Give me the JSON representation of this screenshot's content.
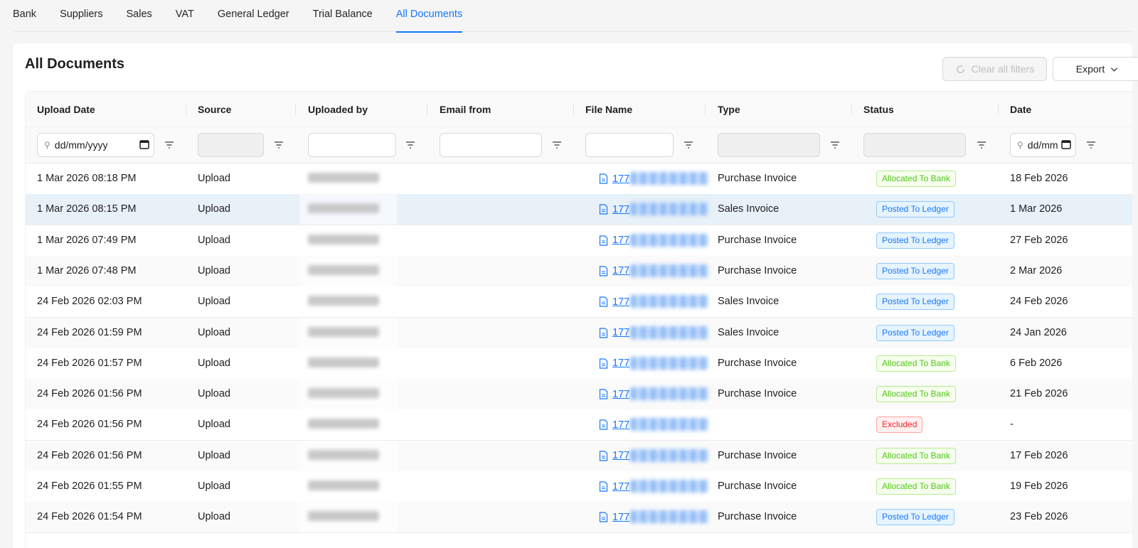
{
  "tabs": [
    {
      "label": "Bank",
      "active": false
    },
    {
      "label": "Suppliers",
      "active": false
    },
    {
      "label": "Sales",
      "active": false
    },
    {
      "label": "VAT",
      "active": false
    },
    {
      "label": "General Ledger",
      "active": false
    },
    {
      "label": "Trial Balance",
      "active": false
    },
    {
      "label": "All Documents",
      "active": true
    }
  ],
  "page": {
    "title": "All Documents",
    "clear_filters_label": "Clear all filters",
    "export_label": "Export"
  },
  "columns": [
    "Upload Date",
    "Source",
    "Uploaded by",
    "Email from",
    "File Name",
    "Type",
    "Status",
    "Date"
  ],
  "filters": {
    "upload_date_placeholder": "dd/mm/yyyy",
    "date_placeholder": "dd/mm"
  },
  "rows": [
    {
      "upload_date": "1 Mar 2026 08:18 PM",
      "source": "Upload",
      "file": "177",
      "type": "Purchase Invoice",
      "status": "Allocated To Bank",
      "status_color": "green",
      "date": "18 Feb 2026"
    },
    {
      "upload_date": "1 Mar 2026 08:15 PM",
      "source": "Upload",
      "file": "177",
      "type": "Sales Invoice",
      "status": "Posted To Ledger",
      "status_color": "blue",
      "date": "1 Mar 2026"
    },
    {
      "upload_date": "1 Mar 2026 07:49 PM",
      "source": "Upload",
      "file": "177",
      "type": "Purchase Invoice",
      "status": "Posted To Ledger",
      "status_color": "blue",
      "date": "27 Feb 2026"
    },
    {
      "upload_date": "1 Mar 2026 07:48 PM",
      "source": "Upload",
      "file": "177",
      "type": "Purchase Invoice",
      "status": "Posted To Ledger",
      "status_color": "blue",
      "date": "2 Mar 2026"
    },
    {
      "upload_date": "24 Feb 2026 02:03 PM",
      "source": "Upload",
      "file": "177",
      "type": "Sales Invoice",
      "status": "Posted To Ledger",
      "status_color": "blue",
      "date": "24 Feb 2026"
    },
    {
      "upload_date": "24 Feb 2026 01:59 PM",
      "source": "Upload",
      "file": "177",
      "type": "Sales Invoice",
      "status": "Posted To Ledger",
      "status_color": "blue",
      "date": "24 Jan 2026"
    },
    {
      "upload_date": "24 Feb 2026 01:57 PM",
      "source": "Upload",
      "file": "177",
      "type": "Purchase Invoice",
      "status": "Allocated To Bank",
      "status_color": "green",
      "date": "6 Feb 2026"
    },
    {
      "upload_date": "24 Feb 2026 01:56 PM",
      "source": "Upload",
      "file": "177",
      "type": "Purchase Invoice",
      "status": "Allocated To Bank",
      "status_color": "green",
      "date": "21 Feb 2026"
    },
    {
      "upload_date": "24 Feb 2026 01:56 PM",
      "source": "Upload",
      "file": "177",
      "type": "",
      "status": "Excluded",
      "status_color": "red",
      "date": "-"
    },
    {
      "upload_date": "24 Feb 2026 01:56 PM",
      "source": "Upload",
      "file": "177",
      "type": "Purchase Invoice",
      "status": "Allocated To Bank",
      "status_color": "green",
      "date": "17 Feb 2026"
    },
    {
      "upload_date": "24 Feb 2026 01:55 PM",
      "source": "Upload",
      "file": "177",
      "type": "Purchase Invoice",
      "status": "Allocated To Bank",
      "status_color": "green",
      "date": "19 Feb 2026"
    },
    {
      "upload_date": "24 Feb 2026 01:54 PM",
      "source": "Upload",
      "file": "177",
      "type": "Purchase Invoice",
      "status": "Posted To Ledger",
      "status_color": "blue",
      "date": "23 Feb 2026"
    }
  ]
}
